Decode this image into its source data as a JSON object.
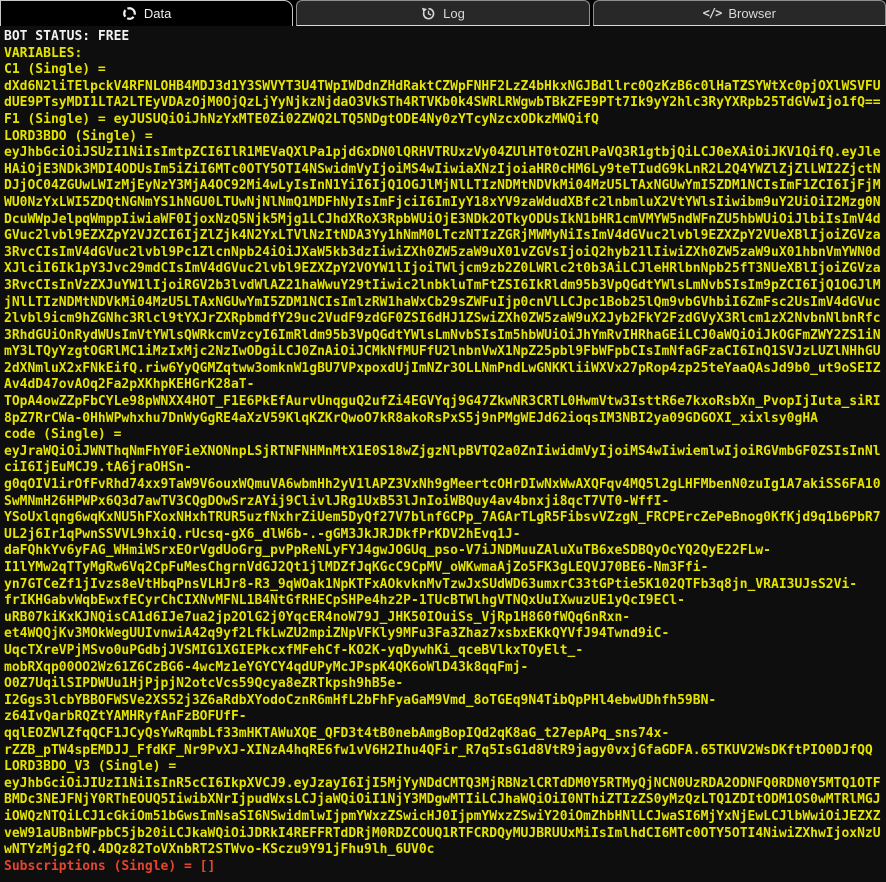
{
  "window": {
    "title": "Bot data panel"
  },
  "colors": {
    "background": "#0e0e0e",
    "tab_inactive_bg": "#282828",
    "tab_border": "#8f8f8f",
    "tab_active_border": "#c6c6c6",
    "text_yellow": "#e5e400",
    "text_white": "#f2f2f2",
    "text_red": "#e8432d"
  },
  "tabs": [
    {
      "label": "Data",
      "icon": "data-ring-icon",
      "active": true
    },
    {
      "label": "Log",
      "icon": "history-icon",
      "active": false
    },
    {
      "label": "Browser",
      "icon": "code-icon",
      "active": false
    }
  ],
  "icons": {
    "code_glyph": "</>"
  },
  "console": {
    "bot_status": "BOT STATUS: FREE",
    "variables_heading": "VARIABLES:",
    "variables": [
      {
        "name": "C1",
        "kind": "Single",
        "header": "C1 (Single) =",
        "color": "yellow",
        "value_lines": [
          "dXd6N2liTElpckV4RFNLOHB4MDJ3d1Y3SWVYT3U4TWpIWDdnZHdRaktCZWpFNHF2LzZ4bHkxNGJBdllrc0QzKzB6c0lHaTZSYWtXc0pjOXlWSVFU",
          "dUE9PTsyMDI1LTA2LTEyVDAzOjM0OjQzLjYyNjkzNjdaO3VkSTh4RTVKb0k4SWRLRWgwbTBkZFE9PTt7Ik9yY2hlc3RyYXRpb25TdGVwIjo1fQ=="
        ]
      },
      {
        "name": "F1",
        "kind": "Single",
        "header": "F1 (Single) = eyJUSUQiOiJhNzYxMTE0Zi02ZWQ2LTQ5NDgtODE4Ny0zYTcyNzcxODkzMWQifQ",
        "color": "yellow",
        "value_lines": []
      },
      {
        "name": "LORD3BDO",
        "kind": "Single",
        "header": "LORD3BDO (Single) =",
        "color": "yellow",
        "value_lines": [
          "eyJhbGciOiJSUzI1NiIsImtpZCI6IlR1MEVaQXlPa1pjdGxDN0lQRHVTRUxzVy04ZUlHT0tOZHlPaVQ3R1gtbjQiLCJ0eXAiOiJKV1QifQ.eyJle",
          "HAiOjE3NDk3MDI4ODUsIm5iZiI6MTc0OTY5OTI4NSwidmVyIjoiMS4wIiwiaXNzIjoiaHR0cHM6Ly9teTIudG9kLnR2L2Q4YWZlZjZlLWI2ZjctN",
          "DJjOC04ZGUwLWIzMjEyNzY3MjA4OC92Mi4wLyIsInN1YiI6IjQ1OGJlMjNlLTIzNDMtNDVkMi04MzU5LTAxNGUwYmI5ZDM1NCIsImF1ZCI6IjFjM",
          "WU0NzYxLWI5ZDQtNGNmYS1hNGU0LTUwNjNlNmQ1MDFhNyIsImFjciI6ImIyY18xYV9zaWdudXBfc2lnbmluX2VtYWlsIiwibm9uY2UiOiI2Mzg0N",
          "DcuWWpJelpqWmppIiwiaWF0IjoxNzQ5Njk5Mjg1LCJhdXRoX3RpbWUiOjE3NDk2OTkyODUsIkN1bHR1cmVMYW5ndWFnZU5hbWUiOiJlbiIsImV4d",
          "GVuc2lvbl9EZXZpY2VJZCI6IjZlZjk4N2YxLTVlNzItNDA3Yy1hNmM0LTczNTIzZGRjMWMyNiIsImV4dGVuc2lvbl9EZXZpY2VUeXBlIjoiZGVza",
          "3RvcCIsImV4dGVuc2lvbl9Pc1ZlcnNpb24iOiJXaW5kb3dzIiwiZXh0ZW5zaW9uX01vZGVsIjoiQ2hyb21lIiwiZXh0ZW5zaW9uX01hbnVmYWN0d",
          "XJlciI6Ik1pY3Jvc29mdCIsImV4dGVuc2lvbl9EZXZpY2VOYW1lIjoiTWljcm9zb2Z0LWRlc2t0b3AiLCJleHRlbnNpb25fT3NUeXBlIjoiZGVza",
          "3RvcCIsInVzZXJuYW1lIjoiRGV2b3lvdWlAZ21haWwuY29tIiwic2lnbkluTmFtZSI6IkRldm95b3VpQGdtYWlsLmNvbSIsIm9pZCI6IjQ1OGJlM",
          "jNlLTIzNDMtNDVkMi04MzU5LTAxNGUwYmI5ZDM1NCIsImlzRW1haWxCb29sZWFuIjp0cnVlLCJpc1Bob25lQm9vbGVhbiI6ZmFsc2UsImV4dGVuc",
          "2lvbl9icm9hZGNhc3Rlcl9tYXJrZXRpbmdfY29uc2VudF9zdGF0ZSI6dHJ1ZSwiZXh0ZW5zaW9uX2Jyb2FkY2FzdGVyX3Rlcm1zX2NvbnNlbnRfc",
          "3RhdGUiOnRydWUsImVtYWlsQWRkcmVzcyI6ImRldm95b3VpQGdtYWlsLmNvbSIsIm5hbWUiOiJhYmRvIHRhaGEiLCJ0aWQiOiJkOGFmZWY2ZS1iN",
          "mY3LTQyYzgtOGRlMC1iMzIxMjc2NzIwODgiLCJ0ZnAiOiJCMkNfMUFfU2lnbnVwX1NpZ25pbl9FbWFpbCIsImNfaGFzaCI6InQ1SVJzLUZlNHhGU",
          "2dXNmluX2xFNkEifQ.riw6YyQGMZqtww3omknW1gBU7VPxpoxdUjImNZr3OLLNmPndLwGNKKliiWXVx27pRop4zp25teYaaQAsJd9b0_ut9oSEIZ",
          "Av4dD47ovAOq2Fa2pXKhpKEHGrK28aT-",
          "TOpA4owZZpFbCYLe98pWNXX4HOT_F1E6PkEfAurvUnqguQ2ufZi4EGVYqj9G47ZkwNR3CRTL0HwmVtw3IsttR6e7kxoRsbXn_PvopIjIuta_siRI",
          "8pZ7RrCWa-0HhWPwhxhu7DnWyGgRE4aXzV59KlqKZKrQwoO7kR8akoRsPxS5j9nPMgWEJd62ioqsIM3NBI2ya09GDGOXI_xixlsy0gHA"
        ]
      },
      {
        "name": "code",
        "kind": "Single",
        "header": "code (Single) =",
        "color": "yellow",
        "value_lines": [
          "eyJraWQiOiJWNThqNmFhY0FieXNONnpLSjRTNFNHMnMtX1E0S18wZjgzNlpBVTQ2a0ZnIiwidmVyIjoiMS4wIiwiemlwIjoiRGVmbGF0ZSIsInNl",
          "ciI6IjEuMCJ9.tA6jraOHSn-",
          "g0qOIV1irOfFvRhd74xx9TaW9V6ouxWQmuVA6wbmHh2yV1lAPZ3VxNh9gMeertcOHrDIwNxWwAXQFqv4MQ5l2gLHFMbenN0zuIg1A7akiSS6FA10",
          "SwMNmH26HPWPx6Q3d7awTV3CQgDOwSrzAYij9ClivlJRg1UxB53lJnIoiWBQuy4av4bnxji8qcT7VT0-WffI-",
          "YSoUxlqng6wqKxNU5hFXoxNHxhTRUR5uzfNxhrZiUem5DyQf27V7blnfGCPp_7AGArTLgR5FibsvVZzgN_FRCPErcZePeBnog0KfKjd9q1b6PbR7",
          "UL2j6Ir1qPwnSSVVL9hxiQ.rUcsq-gX6_dlW6b-.-gGM3JkJRJDkfPrKDV2hEvq1J-",
          "daFQhkYv6yFAG_WHmiWSrxEOrVgdUoGrg_pvPpReNLyFYJ4gwJOGUq_pso-V7iJNDMuuZAluXuTB6xeSDBQyOcYQ2QyE22FLw-",
          "I1lYMw2qTTyMgRw6Vq2CpFuMesChgrnVdGJ2Qt1jlMDZfJqKGcC9CpMV_oWKwmaAjZo5FK3gLEQVJ70BE6-Nm3Ffi-",
          "yn7GTCeZf1jIvzs8eVtHbqPnsVLHJr8-R3_9qWOak1NpKTFxAOkvknMvTzwJxSUdWD63umxrC33tGPtie5K102QTFb3q8jn_VRAI3UJsS2Vi-",
          "frIKHGabvWqbEwxfECyrChCIXNvMFNL1B4NtGfRHECpSHPe4hz2P-1TUcBTWlhgVTNQxUuIXwuzUE1yQcI9ECl-",
          "uRB07kiKxKJNQisCA1d6IJe7ua2jp2OlG2j0YqcER4noW79J_JHK50IOuiSs_VjRp1H860fWQq6nRxn-",
          "et4WQQjKv3MOkWegUUIvnwiA42q9yf2LfkLwZU2mpiZNpVFKly9MFu3Fa3Zhaz7xsbxEKkQYVfJ94Twnd9iC-",
          "UqcTXreVPjMSvo0uPGdbjJVSMIG1XGIEPkcxfMFehCf-KO2K-yqDywhKi_qceBVlkxTOyElt_-",
          "mobRXqp00OO2Wz61Z6CzBG6-4wcMz1eYGYCY4qdUPyMcJPspK4QK6oWlD43k8qqFmj-",
          "O0Z7UqilSIPDWUu1HjPjpjN2otcVcs59Qcya8eZRTkpsh9hB5e-",
          "I2Ggs3lcbYBBOFWSVe2XS52j3Z6aRdbXYodoCznR6mHfL2bFhFyaGaM9Vmd_8oTGEq9N4TibQpPHl4ebwUDhfh59BN-",
          "z64IvQarbRQZtYAMHRyfAnFzBOFUfF-",
          "qqlEOZWlZfqQCF1JCyQsYwRqmbLf33mHKTAWuXQE_QFD3t4tB0nebAmgBopIQd2qK8aG_t27epAPq_sns74x-",
          "rZZB_pTW4spEMDJJ_FfdKF_Nr9PvXJ-XINzA4hqRE6fw1vV6H2Ihu4QFir_R7q5IsG1d8VtR9jagy0vxjGfaGDFA.65TKUV2WsDKftPIO0DJfQQ"
        ]
      },
      {
        "name": "LORD3BDO_V3",
        "kind": "Single",
        "header": "LORD3BDO_V3 (Single) =",
        "color": "yellow",
        "value_lines": [
          "eyJhbGciOiJIUzI1NiIsInR5cCI6IkpXVCJ9.eyJzayI6IjI5MjYyNDdCMTQ3MjRBNzlCRTdDM0Y5RTMyQjNCN0UzRDA2ODNFQ0RDN0Y5MTQ1OTF",
          "BMDc3NEJFNjY0RThEOUQ5IiwibXNrIjpudWxsLCJjaWQiOiI1NjY3MDgwMTIiLCJhaWQiOiI0NThiZTIzZS0yMzQzLTQ1ZDItODM1OS0wMTRlMGJ",
          "iOWQzNTQiLCJ1cGkiOm51bGwsImNsaSI6NSwidmlwIjpmYWxzZSwicHJ0IjpmYWxzZSwiY20iOmZhbHNlLCJwaSI6MjYxNjEwLCJlbWwiOiJEZXZ",
          "veW91aUBnbWFpbC5jb20iLCJkaWQiOiJDRkI4REFFRTdDRjM0RDZCOUQ1RTFCRDQyMUJBRUUxMiIsImlhdCI6MTc0OTY5OTI4NiwiZXhwIjoxNzU",
          "wNTYzMjg2fQ.4DQz82ToVXnbRT2STWvo-KSczu9Y91jFhu9lh_6UV0c"
        ]
      },
      {
        "name": "Subscriptions",
        "kind": "Single",
        "header": "Subscriptions (Single) = []",
        "color": "red",
        "value_lines": []
      }
    ]
  }
}
